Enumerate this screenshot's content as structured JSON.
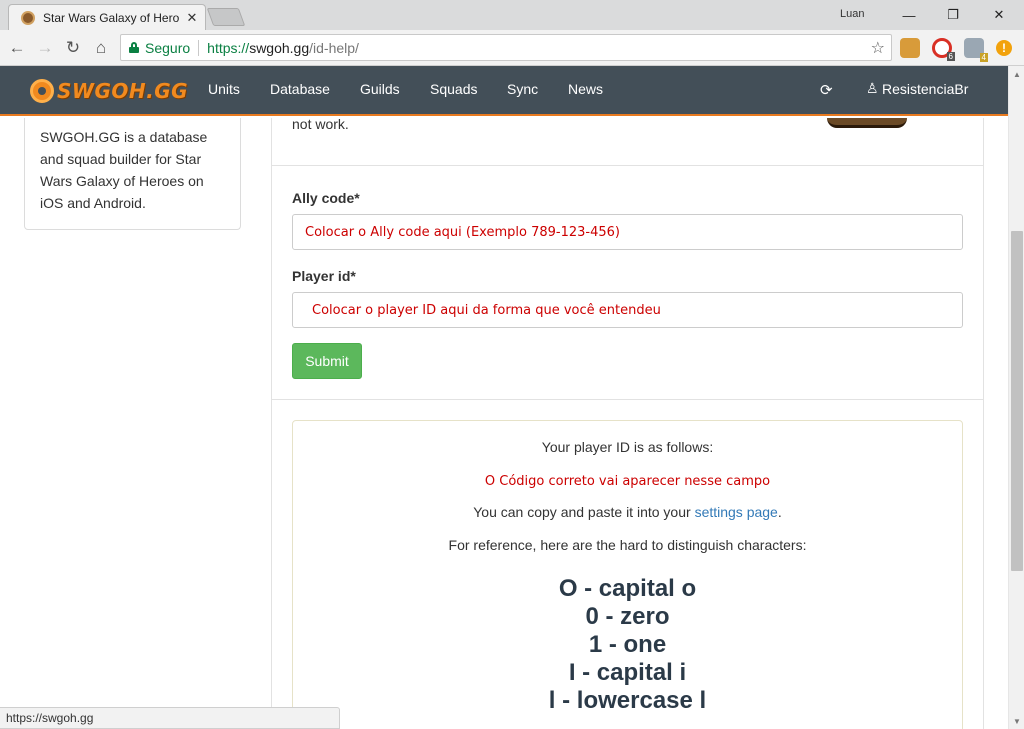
{
  "browser": {
    "tab_title": "Star Wars Galaxy of Hero",
    "tab_close": "✕",
    "user_name": "Luan",
    "secure_label": "Seguro",
    "url_scheme": "https://",
    "url_host": "swgoh.gg",
    "url_path": "/id-help/",
    "ext_badges": [
      "6",
      "4"
    ],
    "status_url": "https://swgoh.gg"
  },
  "nav": {
    "logo_text": "SWGOH.GG",
    "links": [
      "Units",
      "Database",
      "Guilds",
      "Squads",
      "Sync",
      "News"
    ],
    "username": "ResistenciaBr"
  },
  "sidebar": {
    "description": "SWGOH.GG is a database and squad builder for Star Wars Galaxy of Heroes on iOS and Android."
  },
  "form": {
    "top_text": "not work.",
    "ally_label": "Ally code*",
    "ally_value": "Colocar o Ally code aqui (Exemplo 789-123-456)",
    "player_label": "Player id*",
    "player_value": "Colocar o player ID  aqui da forma que você entendeu",
    "submit_label": "Submit"
  },
  "result": {
    "heading": "Your player ID is as follows:",
    "code": "O Código correto vai aparecer nesse campo",
    "copy_prefix": "You can copy and paste it into your ",
    "copy_link": "settings page",
    "copy_suffix": ".",
    "reference": "For reference, here are the hard to distinguish characters:",
    "chars": [
      "O - capital o",
      "0 - zero",
      "1 - one",
      "I - capital i",
      "l - lowercase l"
    ]
  },
  "colors": {
    "nav_bg": "#434f58",
    "accent_orange": "#e87a1f",
    "submit_green": "#5cb85c",
    "annotation_red": "#cc0000",
    "link_blue": "#337ab7"
  }
}
